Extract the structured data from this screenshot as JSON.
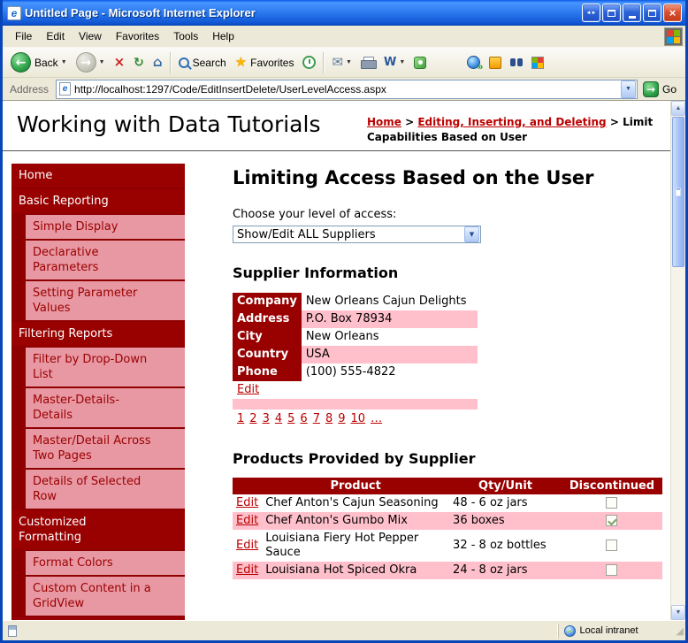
{
  "window": {
    "title": "Untitled Page - Microsoft Internet Explorer",
    "menu": [
      "File",
      "Edit",
      "View",
      "Favorites",
      "Tools",
      "Help"
    ],
    "toolbar": {
      "back": "Back",
      "search": "Search",
      "favorites": "Favorites"
    },
    "address": {
      "label": "Address",
      "url": "http://localhost:1297/Code/EditInsertDelete/UserLevelAccess.aspx",
      "go": "Go"
    },
    "status": {
      "zone": "Local intranet"
    }
  },
  "header": {
    "site_title": "Working with Data Tutorials",
    "breadcrumb": [
      {
        "label": "Home",
        "link": true
      },
      {
        "label": "Editing, Inserting, and Deleting",
        "link": true
      },
      {
        "label": "Limit Capabilities Based on User",
        "link": false
      }
    ]
  },
  "sidebar": [
    {
      "label": "Home",
      "kind": "section"
    },
    {
      "label": "Basic Reporting",
      "kind": "section"
    },
    {
      "label": "Simple Display",
      "kind": "item"
    },
    {
      "label": "Declarative Parameters",
      "kind": "item"
    },
    {
      "label": "Setting Parameter Values",
      "kind": "item"
    },
    {
      "label": "Filtering Reports",
      "kind": "section"
    },
    {
      "label": "Filter by Drop-Down List",
      "kind": "item"
    },
    {
      "label": "Master-Details-Details",
      "kind": "item"
    },
    {
      "label": "Master/Detail Across Two Pages",
      "kind": "item"
    },
    {
      "label": "Details of Selected Row",
      "kind": "item"
    },
    {
      "label": "Customized Formatting",
      "kind": "section"
    },
    {
      "label": "Format Colors",
      "kind": "item"
    },
    {
      "label": "Custom Content in a GridView",
      "kind": "item"
    },
    {
      "label": "",
      "kind": "section-clipped"
    }
  ],
  "content": {
    "page_title": "Limiting Access Based on the User",
    "access_label": "Choose your level of access:",
    "access_selected": "Show/Edit ALL Suppliers",
    "supplier_heading": "Supplier Information",
    "supplier_fields": [
      {
        "label": "Company",
        "value": "New Orleans Cajun Delights"
      },
      {
        "label": "Address",
        "value": "P.O. Box 78934"
      },
      {
        "label": "City",
        "value": "New Orleans"
      },
      {
        "label": "Country",
        "value": "USA"
      },
      {
        "label": "Phone",
        "value": "(100) 555-4822"
      }
    ],
    "supplier_edit": "Edit",
    "pager": [
      "1",
      "2",
      "3",
      "4",
      "5",
      "6",
      "7",
      "8",
      "9",
      "10",
      "…"
    ],
    "products_heading": "Products Provided by Supplier",
    "products_headers": [
      "Product",
      "Qty/Unit",
      "Discontinued"
    ],
    "products_edit": "Edit",
    "products": [
      {
        "product": "Chef Anton's Cajun Seasoning",
        "qty": "48 - 6 oz jars",
        "discontinued": false
      },
      {
        "product": "Chef Anton's Gumbo Mix",
        "qty": "36 boxes",
        "discontinued": true
      },
      {
        "product": "Louisiana Fiery Hot Pepper Sauce",
        "qty": "32 - 8 oz bottles",
        "discontinued": false
      },
      {
        "product": "Louisiana Hot Spiced Okra",
        "qty": "24 - 8 oz jars",
        "discontinued": false
      }
    ]
  },
  "colors": {
    "maroon": "#990000",
    "sidebar_pink": "#E898A3",
    "row_pink": "#FFC0CB",
    "link_red": "#BB0000",
    "titlebar_blue": "#2E7CEF"
  }
}
